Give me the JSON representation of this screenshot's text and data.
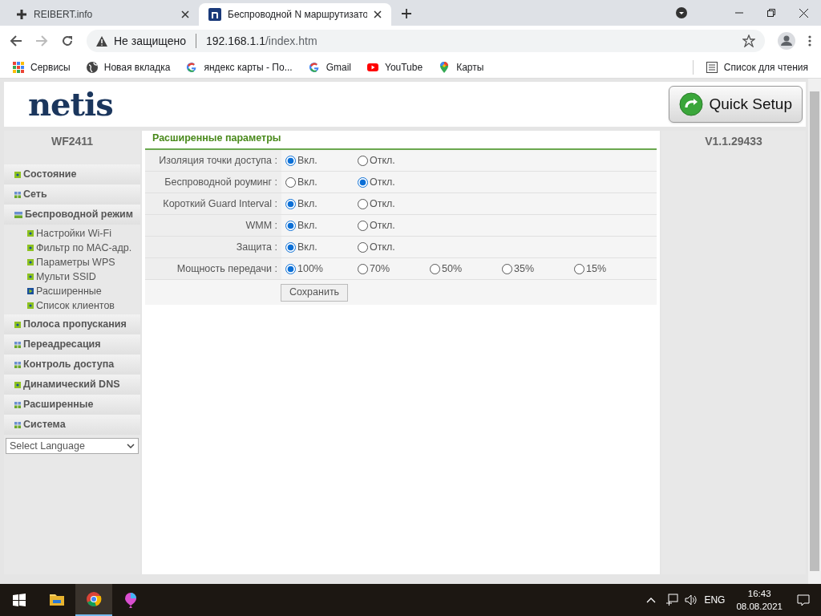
{
  "browser": {
    "tabs": [
      {
        "title": "REIBERT.info",
        "selected": false
      },
      {
        "title": "Беспроводной N маршрутизато",
        "selected": true
      }
    ],
    "address": {
      "security": "Не защищено",
      "url_host": "192.168.1.1",
      "url_path": "/index.htm"
    },
    "bookmarks": [
      {
        "label": "Сервисы"
      },
      {
        "label": "Новая вкладка"
      },
      {
        "label": "яндекс карты - По..."
      },
      {
        "label": "Gmail"
      },
      {
        "label": "YouTube"
      },
      {
        "label": "Карты"
      }
    ],
    "reading_list": "Список для чтения"
  },
  "page": {
    "logo": "netis",
    "quick_setup": "Quick Setup",
    "model": "WF2411",
    "version": "V1.1.29433",
    "menu": [
      {
        "label": "Состояние",
        "kind": "leaf",
        "expanded": false
      },
      {
        "label": "Сеть",
        "kind": "folder",
        "expanded": false
      },
      {
        "label": "Беспроводной режим",
        "expanded": true,
        "children": [
          {
            "label": "Настройки Wi-Fi",
            "selected": false
          },
          {
            "label": "Фильтр по MAC-адр.",
            "selected": false
          },
          {
            "label": "Параметры WPS",
            "selected": false
          },
          {
            "label": "Мульти SSID",
            "selected": false
          },
          {
            "label": "Расширенные",
            "selected": true
          },
          {
            "label": "Список клиентов",
            "selected": false
          }
        ]
      },
      {
        "label": "Полоса пропускания",
        "kind": "leaf",
        "expanded": false
      },
      {
        "label": "Переадресация",
        "kind": "folder",
        "expanded": false
      },
      {
        "label": "Контроль доступа",
        "kind": "folder",
        "expanded": false
      },
      {
        "label": "Динамический DNS",
        "kind": "leaf",
        "expanded": false
      },
      {
        "label": "Расширенные",
        "kind": "folder",
        "expanded": false
      },
      {
        "label": "Система",
        "kind": "folder",
        "expanded": false
      }
    ],
    "language": "Select Language",
    "section_title": "Расширенные параметры",
    "rows": [
      {
        "label": "Изоляция точки доступа :",
        "options": [
          {
            "label": "Вкл.",
            "selected": true
          },
          {
            "label": "Откл.",
            "selected": false
          }
        ]
      },
      {
        "label": "Беспроводной роуминг :",
        "options": [
          {
            "label": "Вкл.",
            "selected": false
          },
          {
            "label": "Откл.",
            "selected": true
          }
        ]
      },
      {
        "label": "Короткий Guard Interval :",
        "options": [
          {
            "label": "Вкл.",
            "selected": true
          },
          {
            "label": "Откл.",
            "selected": false
          }
        ]
      },
      {
        "label": "WMM :",
        "options": [
          {
            "label": "Вкл.",
            "selected": true
          },
          {
            "label": "Откл.",
            "selected": false
          }
        ]
      },
      {
        "label": "Защита :",
        "options": [
          {
            "label": "Вкл.",
            "selected": true
          },
          {
            "label": "Откл.",
            "selected": false
          }
        ]
      },
      {
        "label": "Мощность передачи :",
        "options": [
          {
            "label": "100%",
            "selected": true
          },
          {
            "label": "70%",
            "selected": false
          },
          {
            "label": "50%",
            "selected": false
          },
          {
            "label": "35%",
            "selected": false
          },
          {
            "label": "15%",
            "selected": false
          }
        ]
      }
    ],
    "save": "Сохранить"
  },
  "taskbar": {
    "language": "ENG",
    "time": "16:43",
    "date": "08.08.2021"
  }
}
